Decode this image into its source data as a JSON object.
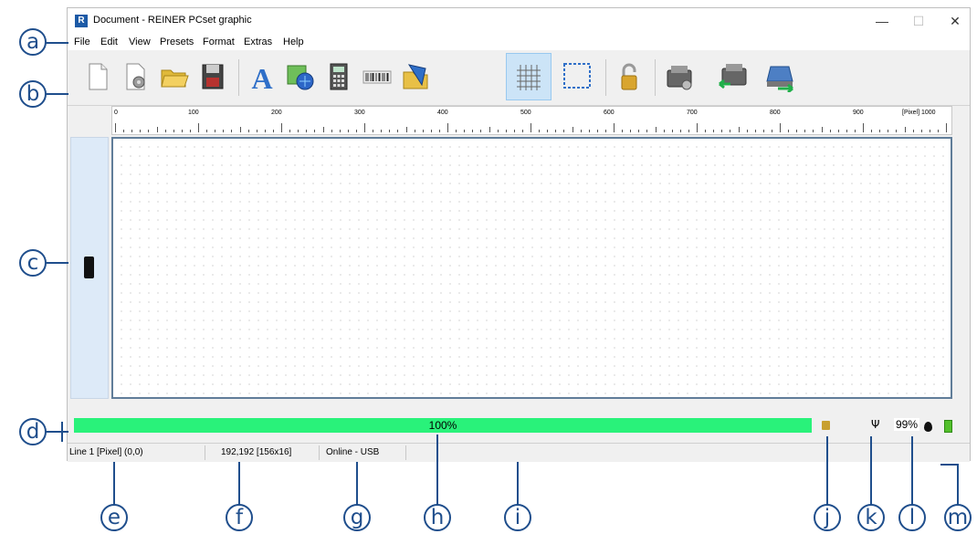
{
  "window": {
    "title": "Document - REINER PCset graphic",
    "app_icon": "R",
    "controls": {
      "minimize": "—",
      "maximize": "☐",
      "close": "✕"
    }
  },
  "menu": [
    "File",
    "Edit",
    "View",
    "Presets",
    "Format",
    "Extras",
    "Help"
  ],
  "toolbar": {
    "buttons": [
      "new-document-icon",
      "open-template-icon",
      "open-folder-icon",
      "save-icon",
      "text-icon",
      "image-icon",
      "calculator-icon",
      "barcode-icon",
      "import-icon",
      "grid-icon",
      "selection-frame-icon",
      "lock-icon",
      "printer-settings-icon",
      "printer-receive-icon",
      "printer-send-icon"
    ],
    "active": "grid-icon"
  },
  "ruler": {
    "labels": [
      "0",
      "100",
      "200",
      "300",
      "400",
      "500",
      "600",
      "700",
      "800",
      "900",
      "[Pixel] 1000"
    ]
  },
  "progress": {
    "text": "100%",
    "fraction": 1.0,
    "color": "#29f27a"
  },
  "tray": {
    "usb_symbol": "Ψ",
    "ink_level": "99%"
  },
  "status": {
    "line": "Line 1 [Pixel] (0,0)",
    "coords": "192,192 [156x16]",
    "connection": "Online - USB"
  },
  "callouts": {
    "a": "a",
    "b": "b",
    "c": "c",
    "d": "d",
    "e": "e",
    "f": "f",
    "g": "g",
    "h": "h",
    "i": "i",
    "j": "j",
    "k": "k",
    "l": "l",
    "m": "m"
  }
}
